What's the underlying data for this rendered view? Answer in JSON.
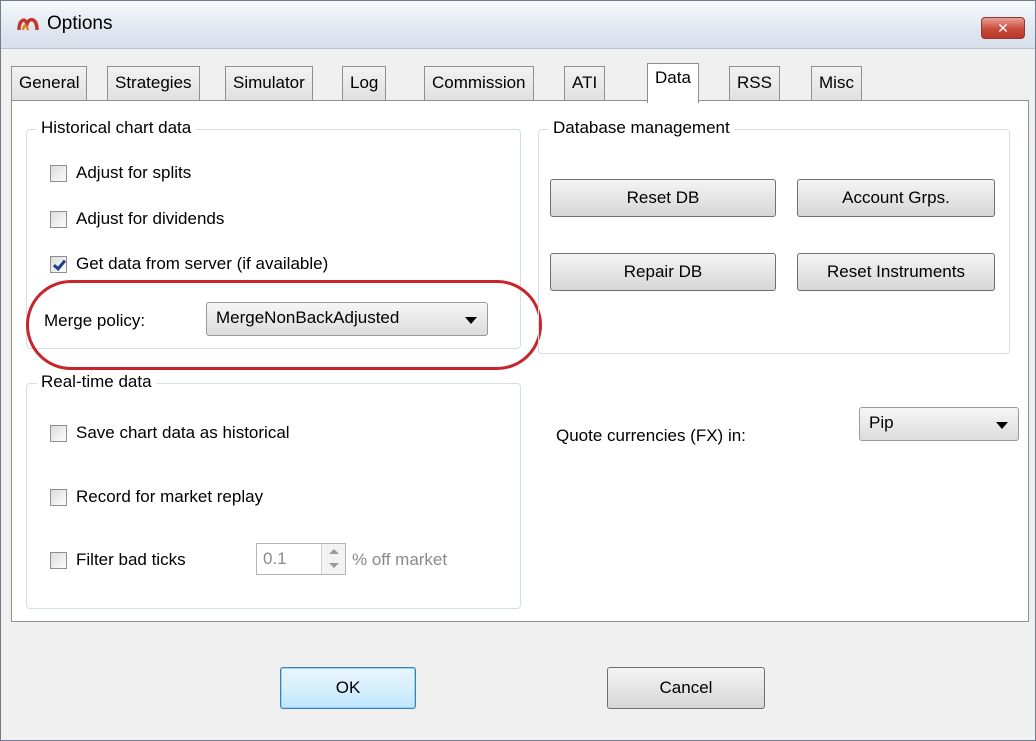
{
  "window": {
    "title": "Options",
    "close_symbol": "✕",
    "icon": "ninjatrader-logo-icon"
  },
  "tabs": [
    {
      "label": "General"
    },
    {
      "label": "Strategies"
    },
    {
      "label": "Simulator"
    },
    {
      "label": "Log"
    },
    {
      "label": "Commission"
    },
    {
      "label": "ATI"
    },
    {
      "label": "Data",
      "active": true
    },
    {
      "label": "RSS"
    },
    {
      "label": "Misc"
    }
  ],
  "historical": {
    "title": "Historical chart data",
    "adjust_splits": {
      "label": "Adjust for splits",
      "checked": false
    },
    "adjust_dividends": {
      "label": "Adjust for dividends",
      "checked": false
    },
    "get_from_server": {
      "label": "Get data from server (if available)",
      "checked": true
    },
    "merge_policy_label": "Merge policy:",
    "merge_policy_value": "MergeNonBackAdjusted"
  },
  "database": {
    "title": "Database management",
    "reset_db": "Reset DB",
    "account_grps": "Account Grps.",
    "repair_db": "Repair DB",
    "reset_instruments": "Reset Instruments"
  },
  "realtime": {
    "title": "Real-time data",
    "save_chart": {
      "label": "Save chart data as historical",
      "checked": false
    },
    "record_replay": {
      "label": "Record for market replay",
      "checked": false
    },
    "filter_bad_ticks": {
      "label": "Filter bad ticks",
      "checked": false
    },
    "filter_value": "0.1",
    "filter_suffix": "% off market"
  },
  "quote": {
    "label": "Quote currencies (FX) in:",
    "value": "Pip"
  },
  "footer": {
    "ok": "OK",
    "cancel": "Cancel"
  },
  "colors": {
    "highlight": "#c8242b",
    "close_button": "#c94c3b",
    "check_mark": "#1f3d8a"
  }
}
